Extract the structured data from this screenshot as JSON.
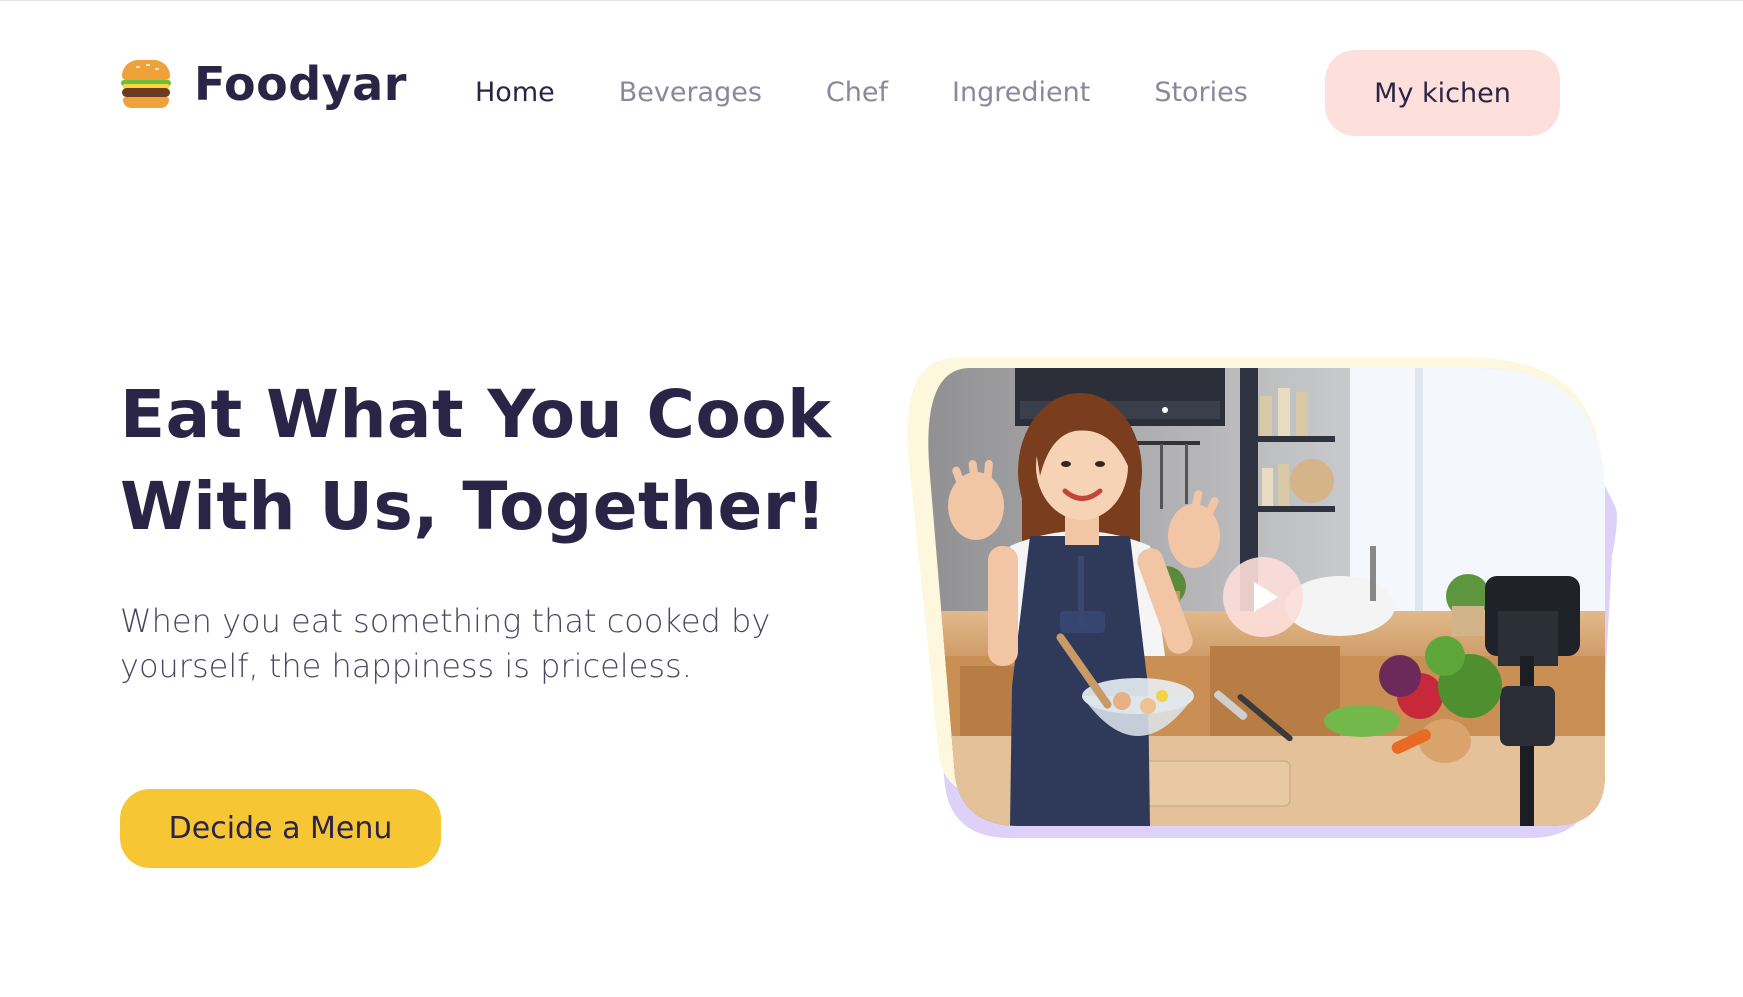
{
  "brand": {
    "logo_icon": "burger-icon",
    "name": "Foodyar"
  },
  "nav": {
    "items": [
      {
        "label": "Home",
        "active": true
      },
      {
        "label": "Beverages",
        "active": false
      },
      {
        "label": "Chef",
        "active": false
      },
      {
        "label": "Ingredient",
        "active": false
      },
      {
        "label": "Stories",
        "active": false
      }
    ],
    "cta_label": "My kichen"
  },
  "hero": {
    "title_line1": "Eat What You Cook",
    "title_line2": "With Us, Together!",
    "subtitle_line1": "When you eat something that cooked by",
    "subtitle_line2": "yourself, the happiness is priceless.",
    "button_label": "Decide a Menu",
    "media_play_icon": "play-icon"
  },
  "colors": {
    "text_dark": "#2a2547",
    "nav_muted": "#8b889e",
    "kitchen_button_bg": "#fde0dc",
    "menu_button_bg": "#f6c634",
    "frame_yellow": "#fdf7dd",
    "frame_purple": "#ddd0f9",
    "play_button_bg": "#fddeda"
  }
}
